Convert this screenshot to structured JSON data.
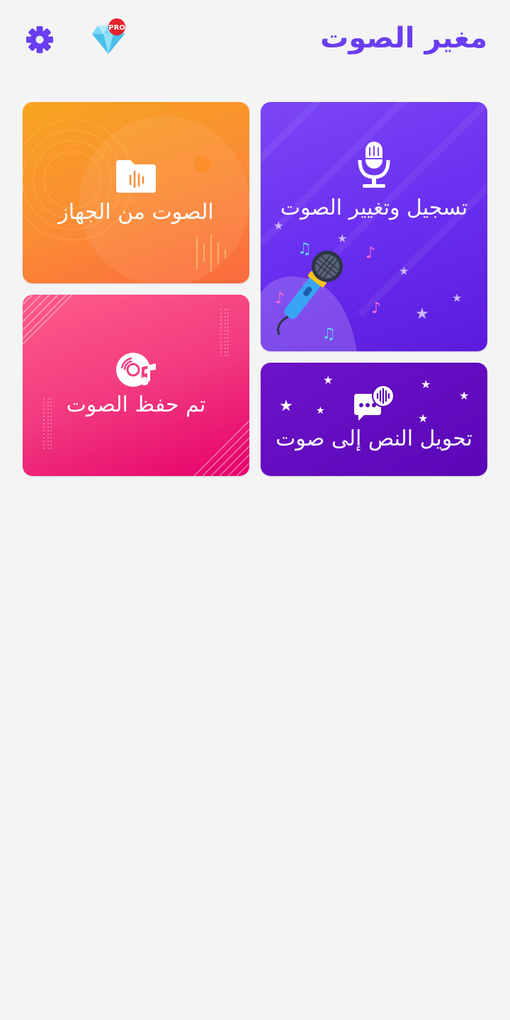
{
  "header": {
    "title": "مغير الصوت",
    "pro_badge": "PRO",
    "settings_icon": "gear-icon",
    "pro_icon": "diamond-icon"
  },
  "cards": {
    "record": {
      "label": "تسجيل وتغيير الصوت",
      "icon": "microphone-icon"
    },
    "tts": {
      "label": "تحويل النص إلى صوت",
      "icon": "speech-bubble-icon"
    },
    "device": {
      "label": "الصوت من الجهاز",
      "icon": "audio-folder-icon"
    },
    "saved": {
      "label": "تم حفظ الصوت",
      "icon": "music-disc-icon"
    }
  },
  "colors": {
    "accent": "#6a3df2",
    "background": "#f4f4f5",
    "record_card": "#6a2ff0",
    "tts_card": "#5a06b7",
    "device_card": "#fb8a35",
    "saved_card": "#f23a80"
  }
}
